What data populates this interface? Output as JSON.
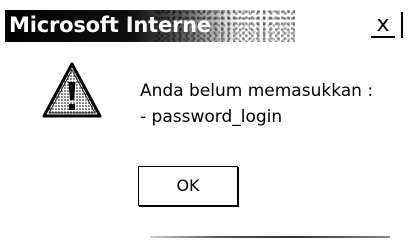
{
  "window": {
    "title": "Microsoft Interne",
    "close_label": "x"
  },
  "dialog": {
    "icon": "warning-icon",
    "message_line1": "Anda belum memasukkan :",
    "message_line2": "- password_login",
    "ok_label": "OK"
  },
  "colors": {
    "titlebar": "#000000",
    "title_text": "#ffffff",
    "background": "#ffffff",
    "text": "#000000"
  }
}
